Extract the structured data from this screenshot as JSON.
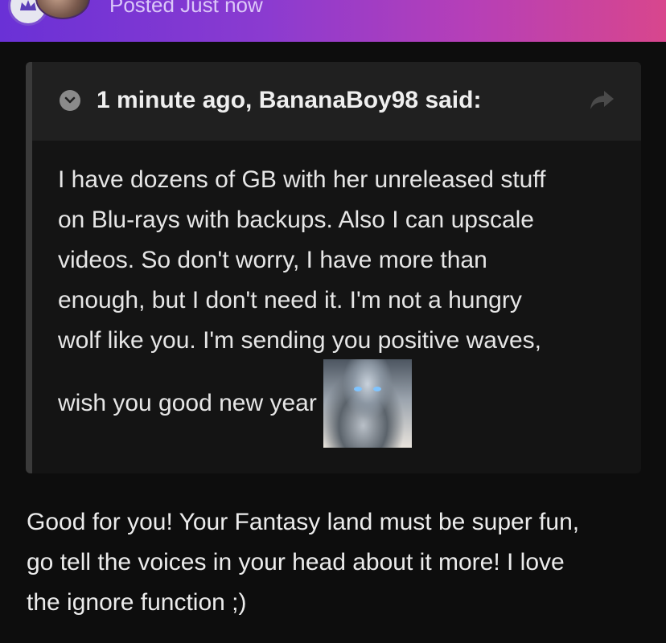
{
  "post_header": {
    "posted_label": "Posted Just now"
  },
  "quote": {
    "citation": "1 minute ago, BananaBoy98 said:",
    "lines": [
      "I have dozens of GB with her unreleased stuff",
      "on Blu-rays with backups. Also I can upscale",
      "videos. So don't worry, I have more than",
      "enough, but I don't need it. I'm not a hungry",
      "wolf like you. I'm sending you positive waves,"
    ],
    "last_line": "wish you good new year"
  },
  "reply": {
    "lines": [
      "Good for you! Your Fantasy land must be super fun,",
      "go tell the voices in your head about it more! I love",
      "the ignore function ;)"
    ]
  },
  "icons": {
    "badge": "rank-badge-icon",
    "collapse": "chevron-down-icon",
    "share": "share-arrow-icon"
  },
  "colors": {
    "header_gradient_start": "#6a31d6",
    "header_gradient_end": "#d8468d",
    "background": "#0d0d0d",
    "quote_background": "#141414",
    "quote_header_background": "#202020"
  }
}
